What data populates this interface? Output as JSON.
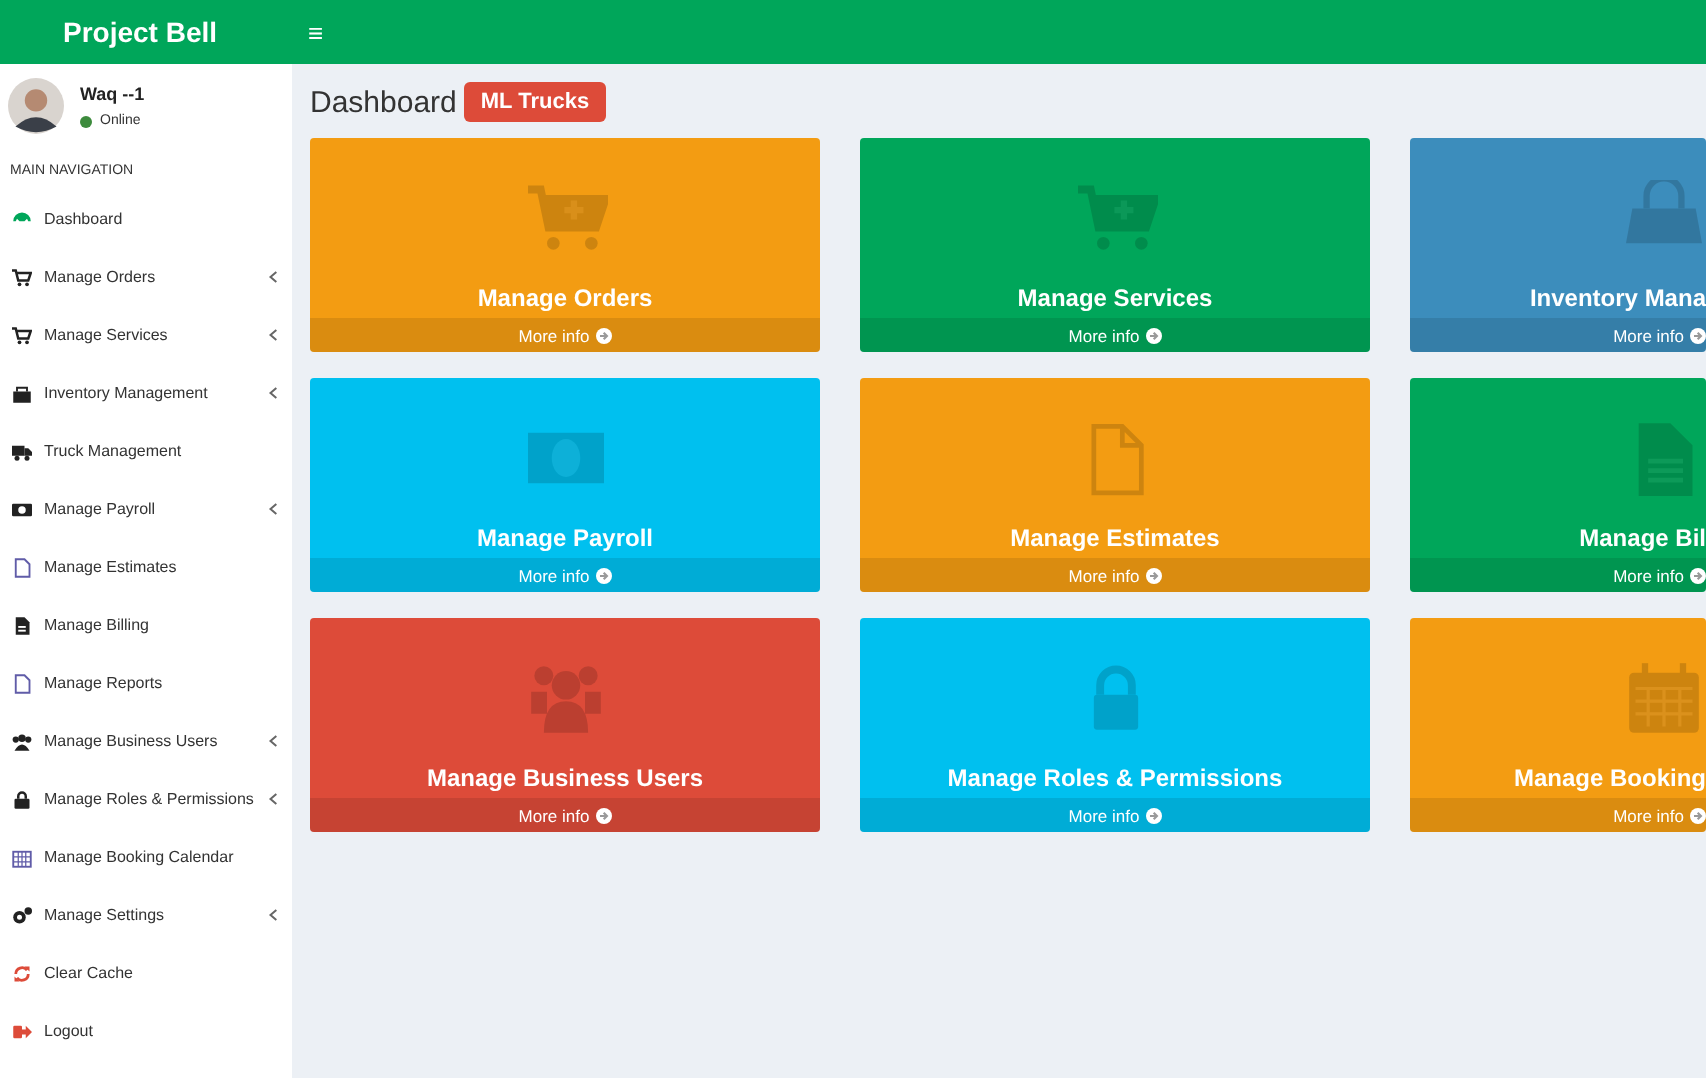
{
  "header": {
    "logo": "Project Bell",
    "menu_toggle": "≡"
  },
  "sidebar": {
    "user": {
      "name": "Waq --1",
      "status": "Online"
    },
    "section": "MAIN NAVIGATION",
    "items": [
      {
        "label": "Dashboard",
        "has_submenu": false
      },
      {
        "label": "Manage Orders",
        "has_submenu": true
      },
      {
        "label": "Manage Services",
        "has_submenu": true
      },
      {
        "label": "Inventory Management",
        "has_submenu": true
      },
      {
        "label": "Truck Management",
        "has_submenu": false
      },
      {
        "label": "Manage Payroll",
        "has_submenu": true
      },
      {
        "label": "Manage Estimates",
        "has_submenu": false
      },
      {
        "label": "Manage Billing",
        "has_submenu": false
      },
      {
        "label": "Manage Reports",
        "has_submenu": false
      },
      {
        "label": "Manage Business Users",
        "has_submenu": true
      },
      {
        "label": "Manage Roles & Permissions",
        "has_submenu": true
      },
      {
        "label": "Manage Booking Calendar",
        "has_submenu": false
      },
      {
        "label": "Manage Settings",
        "has_submenu": true
      },
      {
        "label": "Clear Cache",
        "has_submenu": false
      },
      {
        "label": "Logout",
        "has_submenu": false
      }
    ]
  },
  "page": {
    "title": "Dashboard",
    "badge": "ML Trucks"
  },
  "cards": [
    {
      "title": "Manage Orders",
      "link": "More info",
      "color": "#f39c12",
      "cut": false
    },
    {
      "title": "Manage Services",
      "link": "More info",
      "color": "#00a65a",
      "cut": false
    },
    {
      "title": "Inventory Mana",
      "link": "More info",
      "color": "#3c8dbc",
      "cut": true
    },
    {
      "title": "Manage Payroll",
      "link": "More info",
      "color": "#00c0ef",
      "cut": false
    },
    {
      "title": "Manage Estimates",
      "link": "More info",
      "color": "#f39c12",
      "cut": false
    },
    {
      "title": "Manage Bil",
      "link": "More info",
      "color": "#00a65a",
      "cut": true
    },
    {
      "title": "Manage Business Users",
      "link": "More info",
      "color": "#dd4b39",
      "cut": false
    },
    {
      "title": "Manage Roles & Permissions",
      "link": "More info",
      "color": "#00c0ef",
      "cut": false
    },
    {
      "title": "Manage Booking",
      "link": "More info",
      "color": "#f39c12",
      "cut": true
    }
  ]
}
